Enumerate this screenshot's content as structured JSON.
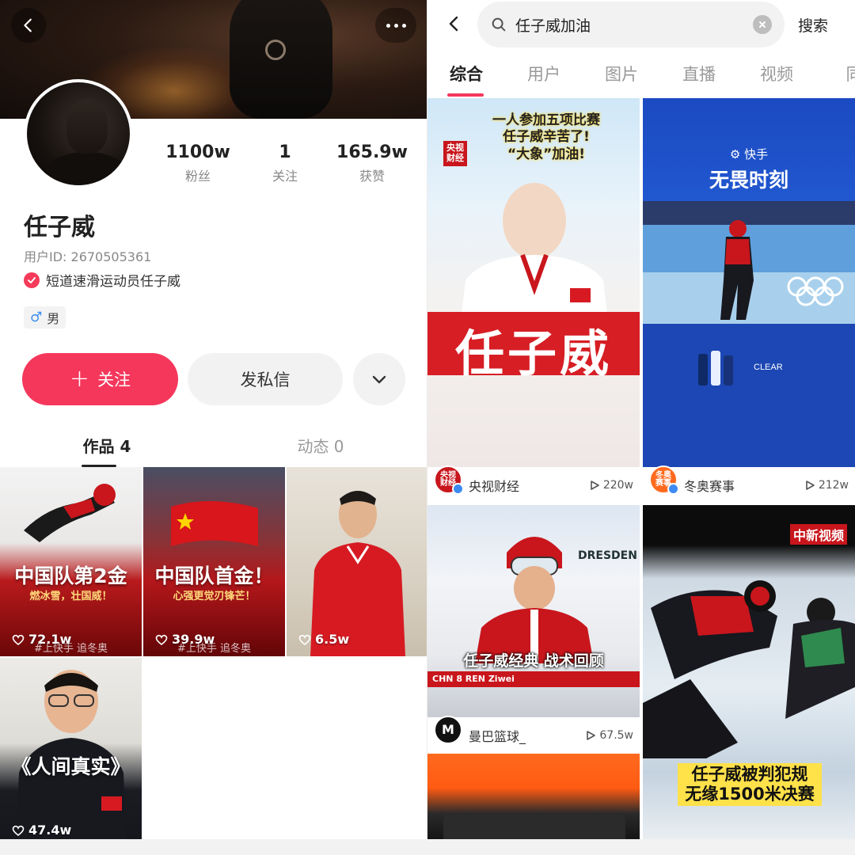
{
  "profile": {
    "stats": [
      {
        "value": "1100w",
        "label": "粉丝"
      },
      {
        "value": "1",
        "label": "关注"
      },
      {
        "value": "165.9w",
        "label": "获赞"
      }
    ],
    "name": "任子威",
    "user_id": "用户ID: 2670505361",
    "verification": "短道速滑运动员任子威",
    "gender": "男",
    "follow_label": "关注",
    "message_label": "发私信",
    "tabs": [
      {
        "label": "作品 4",
        "active": true
      },
      {
        "label": "动态 0",
        "active": false
      }
    ],
    "works": [
      {
        "title": "中国队第2金",
        "subtitle": "燃冰雪，壮国威！",
        "watermark": "#上快手 追冬奥",
        "likes": "72.1w"
      },
      {
        "title": "中国队首金！",
        "subtitle": "心强更觉刃锋芒！",
        "watermark": "#上快手 追冬奥",
        "likes": "39.9w"
      },
      {
        "title": "",
        "subtitle": "",
        "watermark": "",
        "likes": "6.5w"
      },
      {
        "title": "《人间真实》",
        "subtitle": "",
        "watermark": "",
        "likes": "47.4w"
      }
    ]
  },
  "search": {
    "query": "任子威加油",
    "button_label": "搜索",
    "tabs": [
      {
        "label": "综合",
        "active": true
      },
      {
        "label": "用户",
        "active": false
      },
      {
        "label": "图片",
        "active": false
      },
      {
        "label": "直播",
        "active": false
      },
      {
        "label": "视频",
        "active": false
      },
      {
        "label": "同",
        "active": false
      }
    ],
    "results": [
      {
        "overlay": "一人参加五项比赛\n任子威辛苦了!\n“大象”加油!",
        "big_text": "任子威",
        "badge": "央视\n财经",
        "author": "央视财经",
        "author_badge": "央视\n财经",
        "plays": "220w"
      },
      {
        "overlay": "无畏时刻",
        "logo": "快手",
        "author": "冬奥赛事",
        "author_badge": "冬奥\n赛事",
        "plays": "212w"
      },
      {
        "overlay": "任子威经典 战术回顾",
        "caption": "CHN 8 REN Ziwei",
        "banner": "DRESDEN",
        "author": "曼巴篮球_",
        "author_badge": "M",
        "plays": "67.5w"
      },
      {
        "overlay": "任子威被判犯规\n无缘1500米决赛",
        "logo": "中新视频"
      },
      {}
    ]
  },
  "colors": {
    "accent": "#f5375c",
    "verify_blue": "#3d8bf2",
    "gender_blue": "#3a8ef0"
  }
}
